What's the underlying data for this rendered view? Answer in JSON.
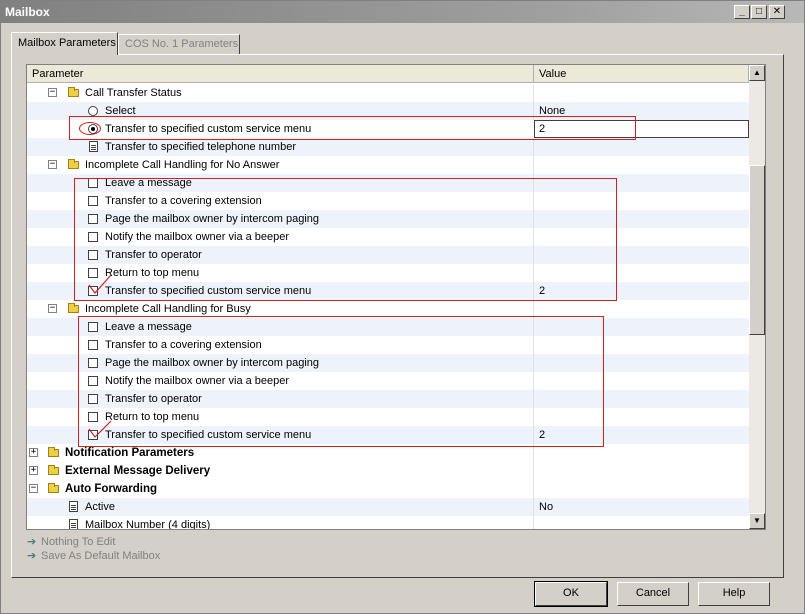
{
  "window": {
    "title": "Mailbox",
    "minimize": "_",
    "maximize": "□",
    "close": "✕"
  },
  "tabs": [
    {
      "label": "Mailbox Parameters"
    },
    {
      "label": "COS No. 1 Parameters"
    }
  ],
  "grid": {
    "columns": {
      "parameter": "Parameter",
      "value": "Value"
    },
    "rows": [
      {
        "label": "Call Transfer Status",
        "value": ""
      },
      {
        "label": "Select",
        "value": "None"
      },
      {
        "label": "Transfer to specified custom service menu",
        "value": "2"
      },
      {
        "label": "Transfer to specified telephone number",
        "value": ""
      },
      {
        "label": "Incomplete Call Handling for No Answer",
        "value": ""
      },
      {
        "label": "Leave a message",
        "value": ""
      },
      {
        "label": "Transfer to a covering extension",
        "value": ""
      },
      {
        "label": "Page the mailbox owner by intercom paging",
        "value": ""
      },
      {
        "label": "Notify the mailbox owner via a beeper",
        "value": ""
      },
      {
        "label": "Transfer to operator",
        "value": ""
      },
      {
        "label": "Return to top menu",
        "value": ""
      },
      {
        "label": "Transfer to specified custom service menu",
        "value": "2"
      },
      {
        "label": "Incomplete Call Handling for Busy",
        "value": ""
      },
      {
        "label": "Leave a message",
        "value": ""
      },
      {
        "label": "Transfer to a covering extension",
        "value": ""
      },
      {
        "label": "Page the mailbox owner by intercom paging",
        "value": ""
      },
      {
        "label": "Notify the mailbox owner via a beeper",
        "value": ""
      },
      {
        "label": "Transfer to operator",
        "value": ""
      },
      {
        "label": "Return to top menu",
        "value": ""
      },
      {
        "label": "Transfer to specified custom service menu",
        "value": "2"
      },
      {
        "label": "Notification Parameters",
        "value": ""
      },
      {
        "label": "External Message Delivery",
        "value": ""
      },
      {
        "label": "Auto Forwarding",
        "value": ""
      },
      {
        "label": "Active",
        "value": "No"
      },
      {
        "label": "Mailbox Number (4 digits)",
        "value": ""
      }
    ]
  },
  "links": [
    {
      "label": "Nothing To Edit"
    },
    {
      "label": "Save As Default Mailbox"
    }
  ],
  "buttons": {
    "ok": "OK",
    "cancel": "Cancel",
    "help": "Help"
  },
  "colors": {
    "annotation": "#d02020",
    "alt_row": "#eef3fb",
    "folder": "#f0d040"
  }
}
